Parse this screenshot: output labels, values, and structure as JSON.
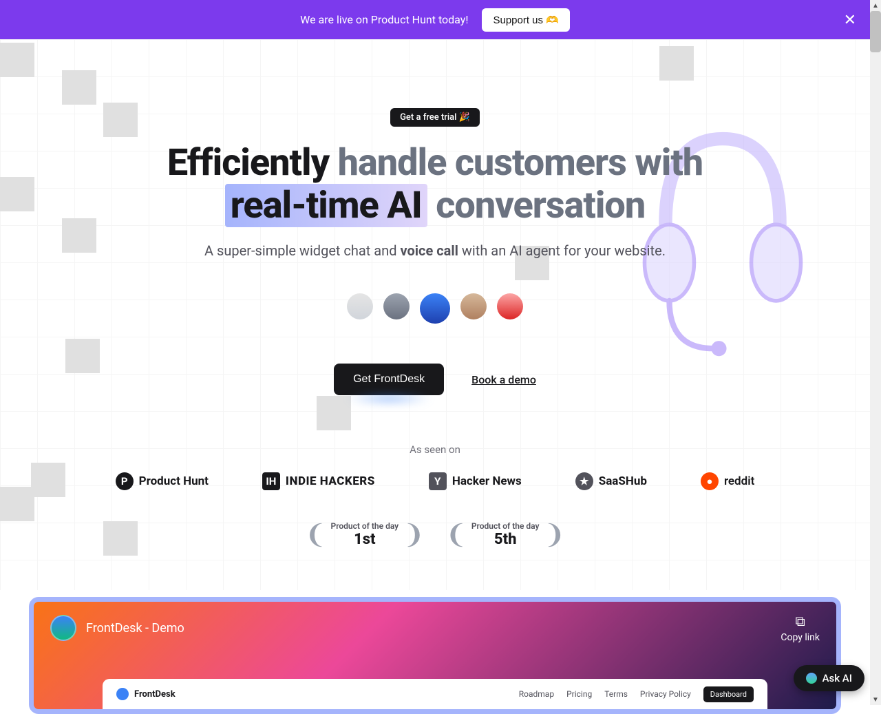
{
  "banner": {
    "text": "We are live on Product Hunt today!",
    "button": "Support us 🫶"
  },
  "hero": {
    "pill": "Get a free trial 🎉",
    "title_dark1": "Efficiently",
    "title_grey1": " handle customers with ",
    "title_highlight": "real-time AI",
    "title_grey2": " conversation",
    "sub_prefix": "A super-simple widget chat and ",
    "sub_bold": "voice call",
    "sub_suffix": " with an AI agent for your website.",
    "cta_primary": "Get FrontDesk",
    "cta_secondary": "Book a demo"
  },
  "seen": {
    "label": "As seen on",
    "logos": {
      "ph": "Product Hunt",
      "ih": "INDIE HACKERS",
      "hn": "Hacker News",
      "sh": "SaaSHub",
      "rd": "reddit"
    }
  },
  "awards": {
    "line": "Product of the day",
    "rank1": "1st",
    "rank2": "5th"
  },
  "video": {
    "title": "FrontDesk - Demo",
    "copy": "Copy link",
    "brand": "FrontDesk",
    "nav": {
      "roadmap": "Roadmap",
      "pricing": "Pricing",
      "terms": "Terms",
      "privacy": "Privacy Policy",
      "dashboard": "Dashboard"
    }
  },
  "ask_ai": "Ask AI"
}
